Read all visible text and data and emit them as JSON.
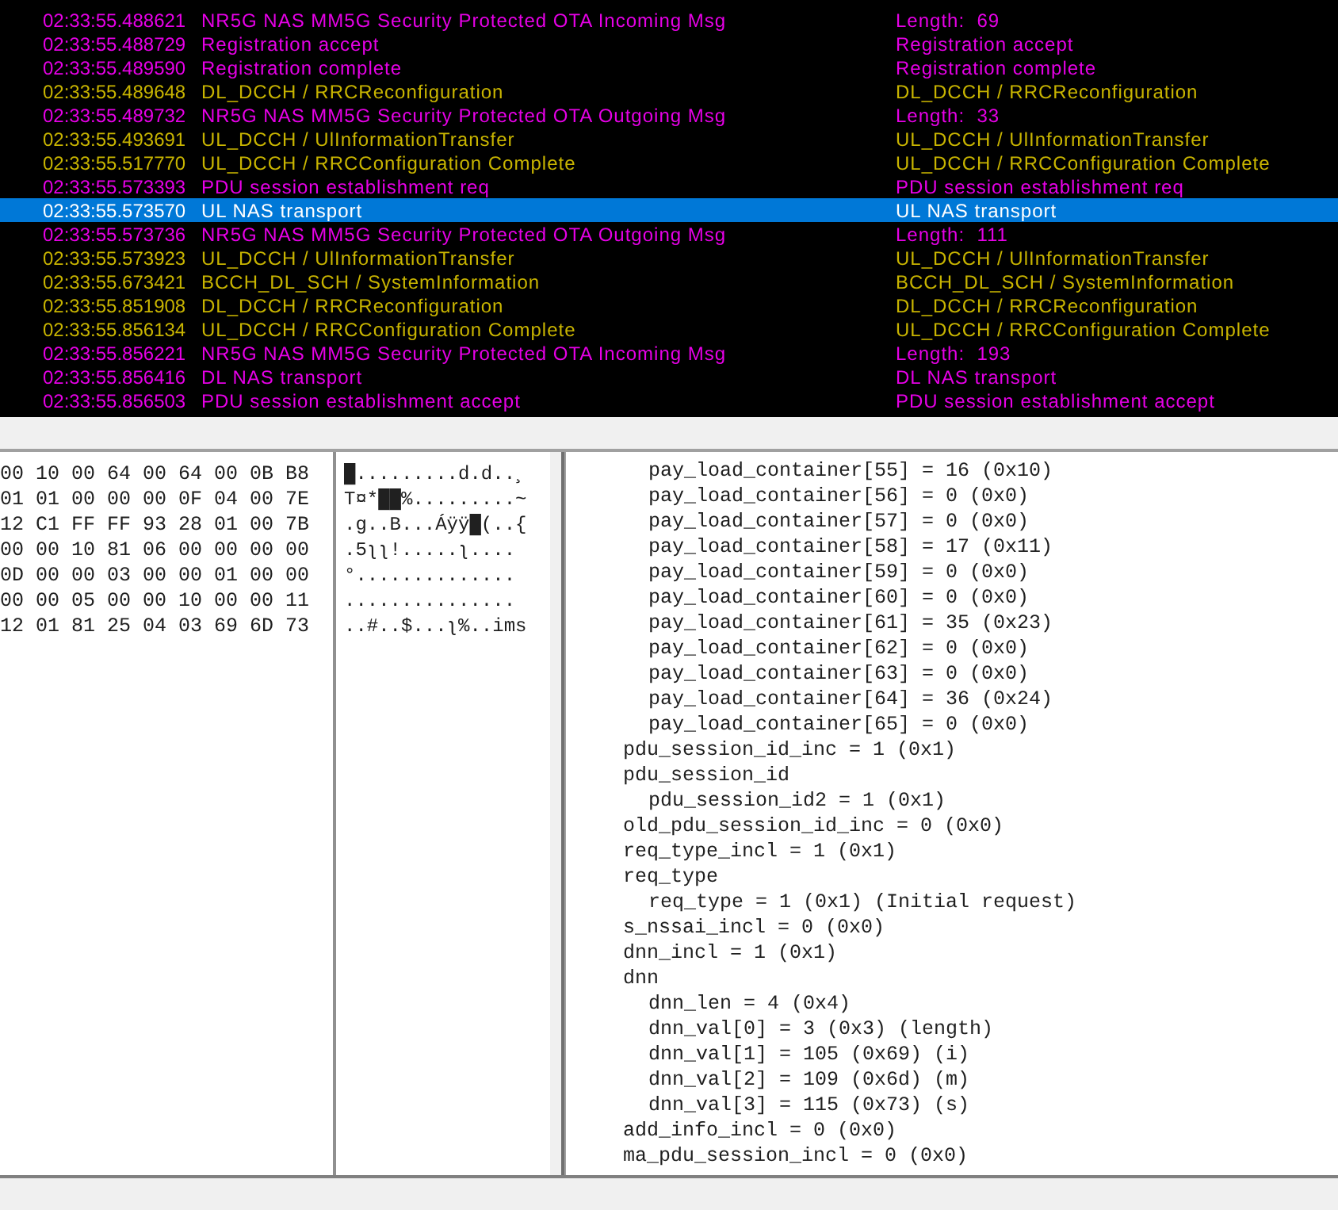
{
  "log": {
    "rows": [
      {
        "time": "02:33:55.488621",
        "message": "NR5G NAS MM5G Security Protected OTA Incoming Msg",
        "summary": "Length:  69",
        "color": "#e600e6",
        "selected": false
      },
      {
        "time": "02:33:55.488729",
        "message": "Registration accept",
        "summary": "Registration accept",
        "color": "#e600e6",
        "selected": false
      },
      {
        "time": "02:33:55.489590",
        "message": "Registration complete",
        "summary": "Registration complete",
        "color": "#e600e6",
        "selected": false
      },
      {
        "time": "02:33:55.489648",
        "message": "DL_DCCH / RRCReconfiguration",
        "summary": "DL_DCCH / RRCReconfiguration",
        "color": "#c8b400",
        "selected": false
      },
      {
        "time": "02:33:55.489732",
        "message": "NR5G NAS MM5G Security Protected OTA Outgoing Msg",
        "summary": "Length:  33",
        "color": "#e600e6",
        "selected": false
      },
      {
        "time": "02:33:55.493691",
        "message": "UL_DCCH / UlInformationTransfer",
        "summary": "UL_DCCH / UlInformationTransfer",
        "color": "#c8b400",
        "selected": false
      },
      {
        "time": "02:33:55.517770",
        "message": "UL_DCCH / RRCConfiguration Complete",
        "summary": "UL_DCCH / RRCConfiguration Complete",
        "color": "#c8b400",
        "selected": false
      },
      {
        "time": "02:33:55.573393",
        "message": "PDU session establishment req",
        "summary": "PDU session establishment req",
        "color": "#e600e6",
        "selected": false
      },
      {
        "time": "02:33:55.573570",
        "message": "UL NAS transport",
        "summary": "UL NAS transport",
        "selected": true
      },
      {
        "time": "02:33:55.573736",
        "message": "NR5G NAS MM5G Security Protected OTA Outgoing Msg",
        "summary": "Length:  111",
        "color": "#e600e6",
        "selected": false
      },
      {
        "time": "02:33:55.573923",
        "message": "UL_DCCH / UlInformationTransfer",
        "summary": "UL_DCCH / UlInformationTransfer",
        "color": "#c8b400",
        "selected": false
      },
      {
        "time": "02:33:55.673421",
        "message": "BCCH_DL_SCH / SystemInformation",
        "summary": "BCCH_DL_SCH / SystemInformation",
        "color": "#c8b400",
        "selected": false
      },
      {
        "time": "02:33:55.851908",
        "message": "DL_DCCH / RRCReconfiguration",
        "summary": "DL_DCCH / RRCReconfiguration",
        "color": "#c8b400",
        "selected": false
      },
      {
        "time": "02:33:55.856134",
        "message": "UL_DCCH / RRCConfiguration Complete",
        "summary": "UL_DCCH / RRCConfiguration Complete",
        "color": "#c8b400",
        "selected": false
      },
      {
        "time": "02:33:55.856221",
        "message": "NR5G NAS MM5G Security Protected OTA Incoming Msg",
        "summary": "Length:  193",
        "color": "#e600e6",
        "selected": false
      },
      {
        "time": "02:33:55.856416",
        "message": "DL NAS transport",
        "summary": "DL NAS transport",
        "color": "#e600e6",
        "selected": false
      },
      {
        "time": "02:33:55.856503",
        "message": "PDU session establishment accept",
        "summary": "PDU session establishment accept",
        "color": "#e600e6",
        "selected": false
      }
    ]
  },
  "hex": {
    "rows": [
      {
        "bytes": "00 10 00 64 00 64 00 0B B8",
        "ascii": "█.........d.d..¸"
      },
      {
        "bytes": "01 01 00 00 00 0F 04 00 7E",
        "ascii": "T¤*██%.........~"
      },
      {
        "bytes": "12 C1 FF FF 93 28 01 00 7B",
        "ascii": ".g..B...Áÿÿ█(..{"
      },
      {
        "bytes": "00 00 10 81 06 00 00 00 00",
        "ascii": ".5ʅʅ!.....ʅ...."
      },
      {
        "bytes": "0D 00 00 03 00 00 01 00 00",
        "ascii": "°.............."
      },
      {
        "bytes": "00 00 05 00 00 10 00 00 11",
        "ascii": "..............."
      },
      {
        "bytes": "12 01 81 25 04 03 69 6D 73",
        "ascii": "..#..$...ʅ%..ims"
      }
    ]
  },
  "details": {
    "items": [
      {
        "children": [
          {
            "children": [
              {
                "text": "pay_load_container[55] = 16 (0x10)"
              },
              {
                "text": "pay_load_container[56] = 0 (0x0)"
              },
              {
                "text": "pay_load_container[57] = 0 (0x0)"
              },
              {
                "text": "pay_load_container[58] = 17 (0x11)"
              },
              {
                "text": "pay_load_container[59] = 0 (0x0)"
              },
              {
                "text": "pay_load_container[60] = 0 (0x0)"
              },
              {
                "text": "pay_load_container[61] = 35 (0x23)"
              },
              {
                "text": "pay_load_container[62] = 0 (0x0)"
              },
              {
                "text": "pay_load_container[63] = 0 (0x0)"
              },
              {
                "text": "pay_load_container[64] = 36 (0x24)"
              },
              {
                "text": "pay_load_container[65] = 0 (0x0)"
              }
            ]
          }
        ]
      },
      {
        "text": "pdu_session_id_inc = 1 (0x1)"
      },
      {
        "text": "pdu_session_id",
        "children": [
          {
            "text": "pdu_session_id2 = 1 (0x1)"
          }
        ]
      },
      {
        "text": "old_pdu_session_id_inc = 0 (0x0)"
      },
      {
        "text": "req_type_incl = 1 (0x1)"
      },
      {
        "text": "req_type",
        "children": [
          {
            "text": "req_type = 1 (0x1) (Initial request)"
          }
        ]
      },
      {
        "text": "s_nssai_incl = 0 (0x0)"
      },
      {
        "text": "dnn_incl = 1 (0x1)"
      },
      {
        "text": "dnn",
        "children": [
          {
            "text": "dnn_len = 4 (0x4)"
          },
          {
            "text": "dnn_val[0] = 3 (0x3) (length)"
          },
          {
            "text": "dnn_val[1] = 105 (0x69) (i)"
          },
          {
            "text": "dnn_val[2] = 109 (0x6d) (m)"
          },
          {
            "text": "dnn_val[3] = 115 (0x73) (s)"
          }
        ]
      },
      {
        "text": "add_info_incl = 0 (0x0)"
      },
      {
        "text": "ma_pdu_session_incl = 0 (0x0)"
      }
    ]
  }
}
